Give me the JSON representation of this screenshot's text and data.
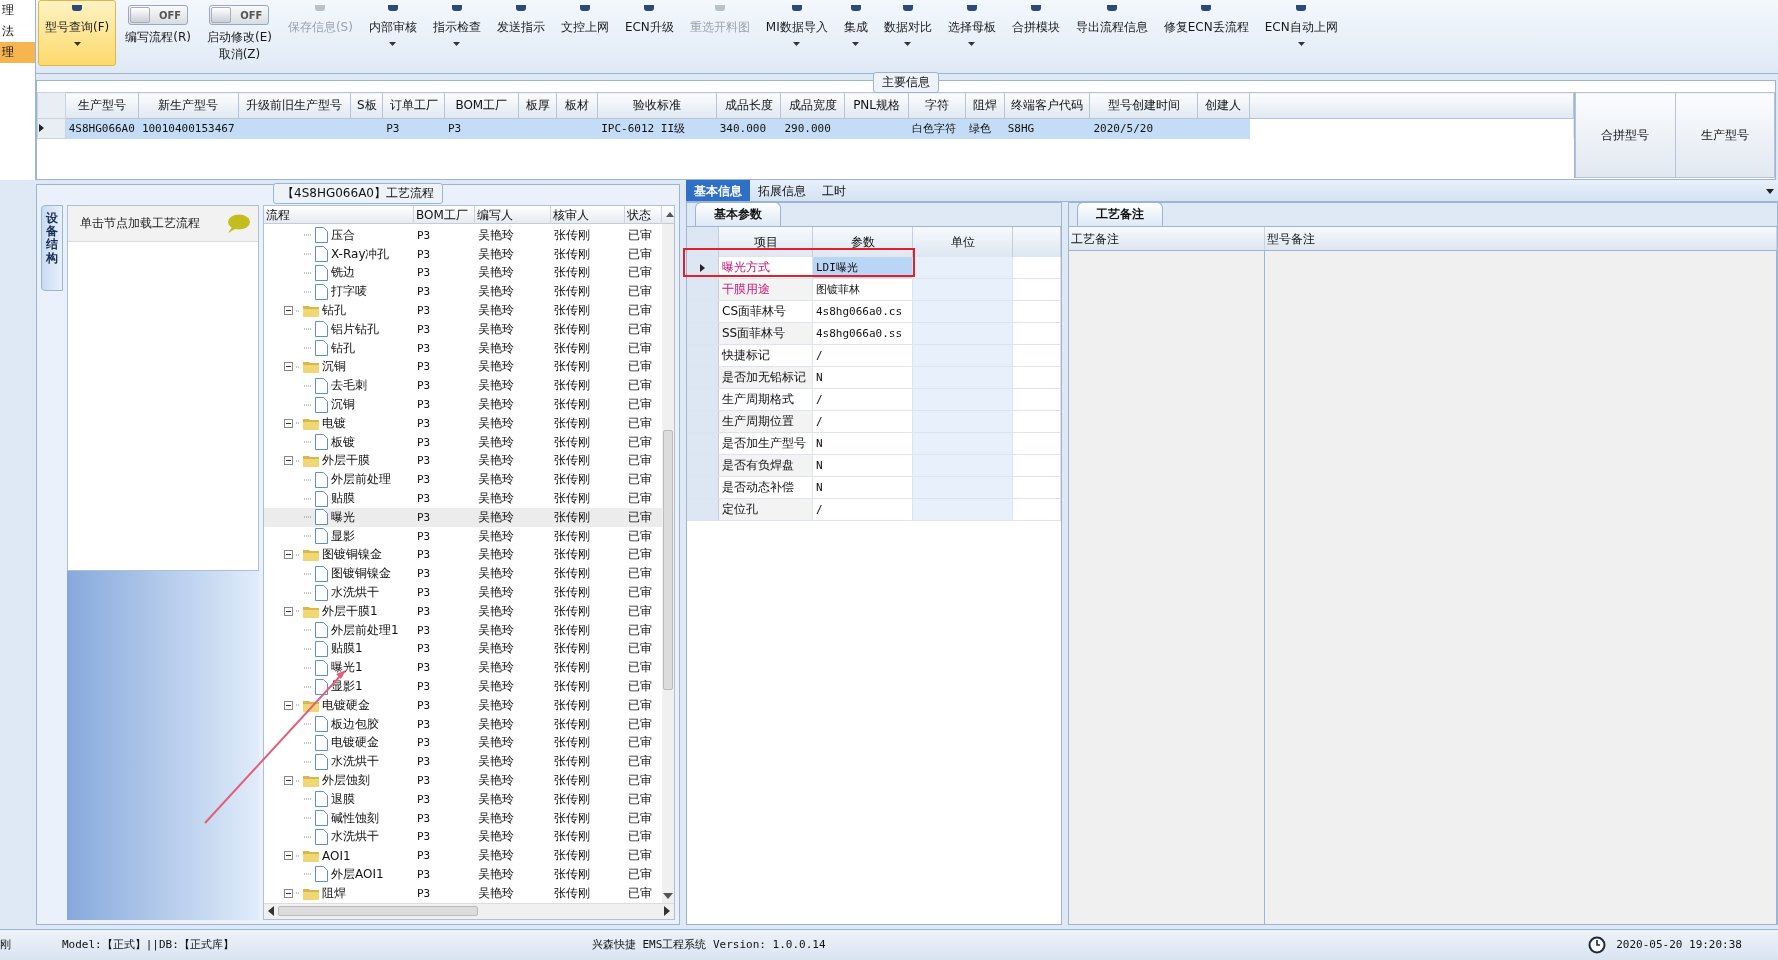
{
  "side_nav": [
    {
      "label": "理",
      "selected": false
    },
    {
      "label": "法",
      "selected": false
    },
    {
      "label": "理",
      "selected": true
    }
  ],
  "toolbar": [
    {
      "label": "型号查询(F)",
      "kind": "dropdown",
      "selected": true,
      "disabled": false
    },
    {
      "label": "编写流程(R)",
      "kind": "toggle",
      "toggle_text": "OFF",
      "on": false,
      "selected": false,
      "disabled": false
    },
    {
      "label": "启动修改(E)",
      "kind": "toggle",
      "toggle_text": "OFF",
      "on": false,
      "sub": "取消(Z)",
      "selected": false,
      "disabled": false
    },
    {
      "label": "保存信息(S)",
      "kind": "button",
      "selected": false,
      "disabled": true
    },
    {
      "label": "内部审核",
      "kind": "dropdown",
      "selected": false,
      "disabled": false
    },
    {
      "label": "指示检查",
      "kind": "dropdown",
      "selected": false,
      "disabled": false
    },
    {
      "label": "发送指示",
      "kind": "button",
      "selected": false,
      "disabled": false
    },
    {
      "label": "文控上网",
      "kind": "button",
      "selected": false,
      "disabled": false
    },
    {
      "label": "ECN升级",
      "kind": "button",
      "selected": false,
      "disabled": false
    },
    {
      "label": "重选开料图",
      "kind": "button",
      "selected": false,
      "disabled": true
    },
    {
      "label": "MI数据导入",
      "kind": "dropdown",
      "selected": false,
      "disabled": false
    },
    {
      "label": "集成",
      "kind": "dropdown",
      "selected": false,
      "disabled": false
    },
    {
      "label": "数据对比",
      "kind": "dropdown",
      "selected": false,
      "disabled": false
    },
    {
      "label": "选择母板",
      "kind": "dropdown",
      "selected": false,
      "disabled": false
    },
    {
      "label": "合拼模块",
      "kind": "button",
      "selected": false,
      "disabled": false
    },
    {
      "label": "导出流程信息",
      "kind": "button",
      "selected": false,
      "disabled": false
    },
    {
      "label": "修复ECN丢流程",
      "kind": "button",
      "selected": false,
      "disabled": false
    },
    {
      "label": "ECN自动上网",
      "kind": "dropdown",
      "selected": false,
      "disabled": false
    }
  ],
  "main_info": {
    "title": "主要信息",
    "columns": [
      "生产型号",
      "新生产型号",
      "升级前旧生产型号",
      "S板",
      "订单工厂",
      "BOM工厂",
      "板厚",
      "板材",
      "验收标准",
      "成品长度",
      "成品宽度",
      "PNL规格",
      "字符",
      "阻焊",
      "终端客户代码",
      "型号创建时间",
      "创建人"
    ],
    "rows": [
      {
        "selected": true,
        "cells": [
          "4S8HG066A0",
          "10010400153467",
          "",
          "",
          "P3",
          "P3",
          "",
          "",
          "IPC-6012 II级",
          "340.000",
          "290.000",
          "",
          "白色字符",
          "绿色",
          "S8HG",
          "2020/5/20",
          ""
        ]
      }
    ],
    "side_columns": [
      "合拼型号",
      "生产型号"
    ]
  },
  "process": {
    "title": "【4S8HG066A0】工艺流程",
    "vertical_tab": "设备结构",
    "hint": "单击节点加载工艺流程",
    "columns": [
      "流程",
      "BOM工厂",
      "编写人",
      "核审人",
      "状态"
    ],
    "tree": [
      {
        "kind": "step",
        "label": "压合",
        "bom": "P3",
        "writer": "吴艳玲",
        "reviewer": "张传刚",
        "status": "已审",
        "selected": false
      },
      {
        "kind": "step",
        "label": "X-Ray冲孔",
        "bom": "P3",
        "writer": "吴艳玲",
        "reviewer": "张传刚",
        "status": "已审",
        "selected": false
      },
      {
        "kind": "step",
        "label": "铣边",
        "bom": "P3",
        "writer": "吴艳玲",
        "reviewer": "张传刚",
        "status": "已审",
        "selected": false
      },
      {
        "kind": "step",
        "label": "打字唛",
        "bom": "P3",
        "writer": "吴艳玲",
        "reviewer": "张传刚",
        "status": "已审",
        "selected": false
      },
      {
        "kind": "group",
        "label": "钻孔",
        "bom": "P3",
        "writer": "吴艳玲",
        "reviewer": "张传刚",
        "status": "已审",
        "selected": false,
        "expanded": true,
        "children": [
          {
            "kind": "step",
            "label": "铝片钻孔",
            "bom": "P3",
            "writer": "吴艳玲",
            "reviewer": "张传刚",
            "status": "已审",
            "selected": false
          },
          {
            "kind": "step",
            "label": "钻孔",
            "bom": "P3",
            "writer": "吴艳玲",
            "reviewer": "张传刚",
            "status": "已审",
            "selected": false
          }
        ]
      },
      {
        "kind": "group",
        "label": "沉铜",
        "bom": "P3",
        "writer": "吴艳玲",
        "reviewer": "张传刚",
        "status": "已审",
        "selected": false,
        "expanded": true,
        "children": [
          {
            "kind": "step",
            "label": "去毛刺",
            "bom": "P3",
            "writer": "吴艳玲",
            "reviewer": "张传刚",
            "status": "已审",
            "selected": false
          },
          {
            "kind": "step",
            "label": "沉铜",
            "bom": "P3",
            "writer": "吴艳玲",
            "reviewer": "张传刚",
            "status": "已审",
            "selected": false
          }
        ]
      },
      {
        "kind": "group",
        "label": "电镀",
        "bom": "P3",
        "writer": "吴艳玲",
        "reviewer": "张传刚",
        "status": "已审",
        "selected": false,
        "expanded": true,
        "children": [
          {
            "kind": "step",
            "label": "板镀",
            "bom": "P3",
            "writer": "吴艳玲",
            "reviewer": "张传刚",
            "status": "已审",
            "selected": false
          }
        ]
      },
      {
        "kind": "group",
        "label": "外层干膜",
        "bom": "P3",
        "writer": "吴艳玲",
        "reviewer": "张传刚",
        "status": "已审",
        "selected": false,
        "expanded": true,
        "children": [
          {
            "kind": "step",
            "label": "外层前处理",
            "bom": "P3",
            "writer": "吴艳玲",
            "reviewer": "张传刚",
            "status": "已审",
            "selected": false
          },
          {
            "kind": "step",
            "label": "贴膜",
            "bom": "P3",
            "writer": "吴艳玲",
            "reviewer": "张传刚",
            "status": "已审",
            "selected": false
          },
          {
            "kind": "step",
            "label": "曝光",
            "bom": "P3",
            "writer": "吴艳玲",
            "reviewer": "张传刚",
            "status": "已审",
            "selected": true
          },
          {
            "kind": "step",
            "label": "显影",
            "bom": "P3",
            "writer": "吴艳玲",
            "reviewer": "张传刚",
            "status": "已审",
            "selected": false
          }
        ]
      },
      {
        "kind": "group",
        "label": "图镀铜镍金",
        "bom": "P3",
        "writer": "吴艳玲",
        "reviewer": "张传刚",
        "status": "已审",
        "selected": false,
        "expanded": true,
        "children": [
          {
            "kind": "step",
            "label": "图镀铜镍金",
            "bom": "P3",
            "writer": "吴艳玲",
            "reviewer": "张传刚",
            "status": "已审",
            "selected": false
          },
          {
            "kind": "step",
            "label": "水洗烘干",
            "bom": "P3",
            "writer": "吴艳玲",
            "reviewer": "张传刚",
            "status": "已审",
            "selected": false
          }
        ]
      },
      {
        "kind": "group",
        "label": "外层干膜1",
        "bom": "P3",
        "writer": "吴艳玲",
        "reviewer": "张传刚",
        "status": "已审",
        "selected": false,
        "expanded": true,
        "children": [
          {
            "kind": "step",
            "label": "外层前处理1",
            "bom": "P3",
            "writer": "吴艳玲",
            "reviewer": "张传刚",
            "status": "已审",
            "selected": false
          },
          {
            "kind": "step",
            "label": "贴膜1",
            "bom": "P3",
            "writer": "吴艳玲",
            "reviewer": "张传刚",
            "status": "已审",
            "selected": false
          },
          {
            "kind": "step",
            "label": "曝光1",
            "bom": "P3",
            "writer": "吴艳玲",
            "reviewer": "张传刚",
            "status": "已审",
            "selected": false
          },
          {
            "kind": "step",
            "label": "显影1",
            "bom": "P3",
            "writer": "吴艳玲",
            "reviewer": "张传刚",
            "status": "已审",
            "selected": false
          }
        ]
      },
      {
        "kind": "group",
        "label": "电镀硬金",
        "bom": "P3",
        "writer": "吴艳玲",
        "reviewer": "张传刚",
        "status": "已审",
        "selected": false,
        "expanded": true,
        "children": [
          {
            "kind": "step",
            "label": "板边包胶",
            "bom": "P3",
            "writer": "吴艳玲",
            "reviewer": "张传刚",
            "status": "已审",
            "selected": false
          },
          {
            "kind": "step",
            "label": "电镀硬金",
            "bom": "P3",
            "writer": "吴艳玲",
            "reviewer": "张传刚",
            "status": "已审",
            "selected": false
          },
          {
            "kind": "step",
            "label": "水洗烘干",
            "bom": "P3",
            "writer": "吴艳玲",
            "reviewer": "张传刚",
            "status": "已审",
            "selected": false
          }
        ]
      },
      {
        "kind": "group",
        "label": "外层蚀刻",
        "bom": "P3",
        "writer": "吴艳玲",
        "reviewer": "张传刚",
        "status": "已审",
        "selected": false,
        "expanded": true,
        "children": [
          {
            "kind": "step",
            "label": "退膜",
            "bom": "P3",
            "writer": "吴艳玲",
            "reviewer": "张传刚",
            "status": "已审",
            "selected": false
          },
          {
            "kind": "step",
            "label": "碱性蚀刻",
            "bom": "P3",
            "writer": "吴艳玲",
            "reviewer": "张传刚",
            "status": "已审",
            "selected": false
          },
          {
            "kind": "step",
            "label": "水洗烘干",
            "bom": "P3",
            "writer": "吴艳玲",
            "reviewer": "张传刚",
            "status": "已审",
            "selected": false
          }
        ]
      },
      {
        "kind": "group",
        "label": "AOI1",
        "bom": "P3",
        "writer": "吴艳玲",
        "reviewer": "张传刚",
        "status": "已审",
        "selected": false,
        "expanded": true,
        "children": [
          {
            "kind": "step",
            "label": "外层AOI1",
            "bom": "P3",
            "writer": "吴艳玲",
            "reviewer": "张传刚",
            "status": "已审",
            "selected": false
          }
        ]
      },
      {
        "kind": "group",
        "label": "阻焊",
        "bom": "P3",
        "writer": "吴艳玲",
        "reviewer": "张传刚",
        "status": "已审",
        "selected": false,
        "expanded": true
      }
    ]
  },
  "detail_tabs": [
    {
      "label": "基本信息",
      "selected": true
    },
    {
      "label": "拓展信息",
      "selected": false
    },
    {
      "label": "工时",
      "selected": false
    }
  ],
  "params": {
    "tab": "基本参数",
    "columns": [
      "项目",
      "参数",
      "单位"
    ],
    "rows": [
      {
        "item": "曝光方式",
        "value": "LDI曝光",
        "required": true,
        "selected": true
      },
      {
        "item": "干膜用途",
        "value": "图镀菲林",
        "required": true,
        "selected": false
      },
      {
        "item": "CS面菲林号",
        "value": "4s8hg066a0.cs",
        "required": false,
        "selected": false
      },
      {
        "item": "SS面菲林号",
        "value": "4s8hg066a0.ss",
        "required": false,
        "selected": false
      },
      {
        "item": "快捷标记",
        "value": "/",
        "required": false,
        "selected": false
      },
      {
        "item": "是否加无铅标记",
        "value": "N",
        "required": false,
        "selected": false
      },
      {
        "item": "生产周期格式",
        "value": "/",
        "required": false,
        "selected": false
      },
      {
        "item": "生产周期位置",
        "value": "/",
        "required": false,
        "selected": false
      },
      {
        "item": "是否加生产型号",
        "value": "N",
        "required": false,
        "selected": false
      },
      {
        "item": "是否有负焊盘",
        "value": "N",
        "required": false,
        "selected": false
      },
      {
        "item": "是否动态补偿",
        "value": "N",
        "required": false,
        "selected": false
      },
      {
        "item": "定位孔",
        "value": "/",
        "required": false,
        "selected": false
      }
    ]
  },
  "remarks": {
    "tab": "工艺备注",
    "columns": [
      "工艺备注",
      "型号备注"
    ]
  },
  "status_bar": {
    "user": "刚",
    "model": "Model:【正式】||DB:【正式库】",
    "app": "兴森快捷 EMS工程系统 Version: 1.0.0.14",
    "time": "2020-05-20 19:20:38"
  }
}
